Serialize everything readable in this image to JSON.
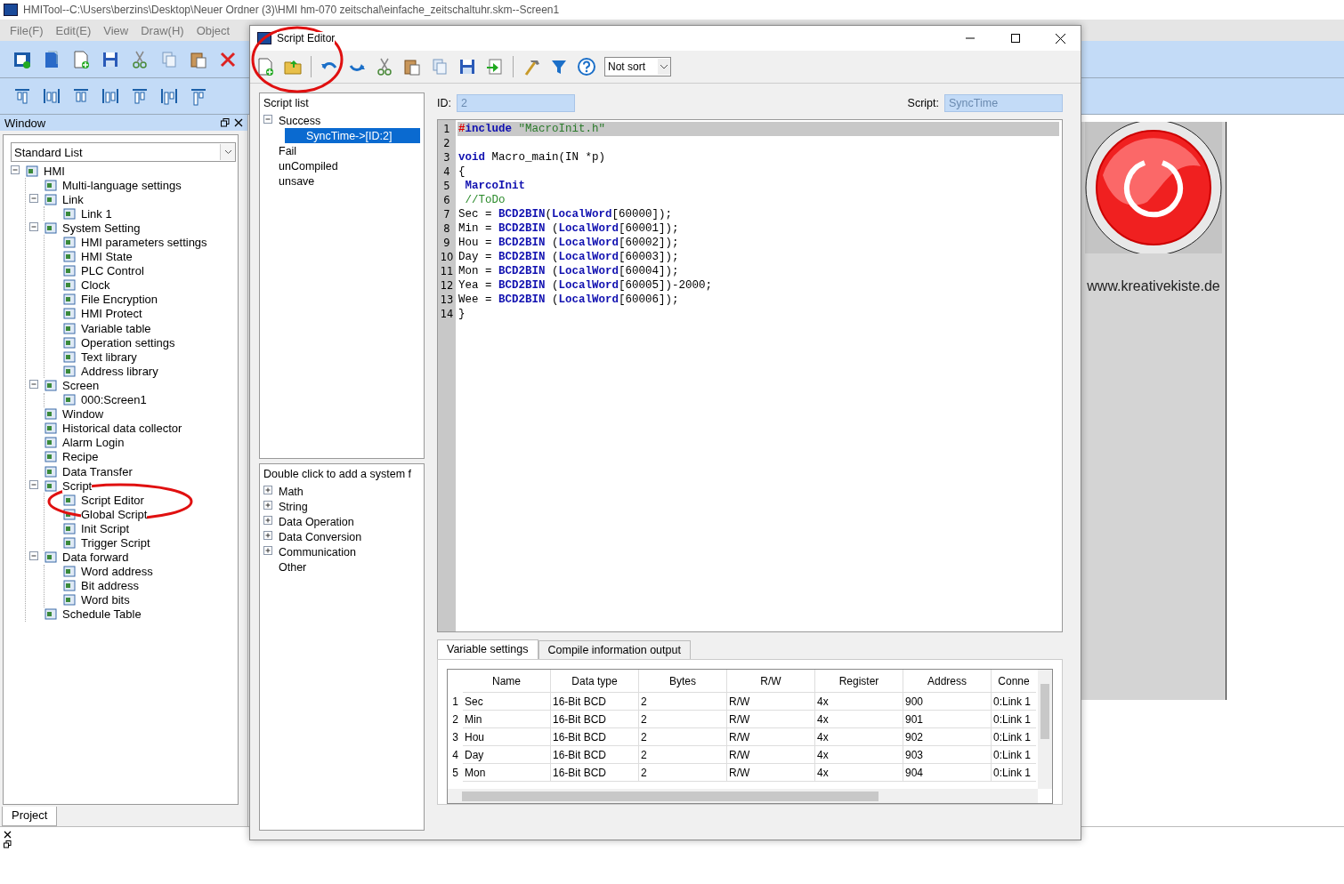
{
  "window": {
    "title": "HMITool--C:\\Users\\berzins\\Desktop\\Neuer Ordner (3)\\HMI hm-070 zeitschal\\einfache_zeitschaltuhr.skm--Screen1"
  },
  "menu": [
    "File(F)",
    "Edit(E)",
    "View",
    "Draw(H)",
    "Object"
  ],
  "left_panel": {
    "title": "Window",
    "dropdown": "Standard List",
    "tab": "Project",
    "tree": [
      {
        "label": "HMI",
        "expanded": true,
        "children": [
          {
            "label": "Multi-language settings"
          },
          {
            "label": "Link",
            "expanded": true,
            "children": [
              {
                "label": "Link 1"
              }
            ]
          },
          {
            "label": "System Setting",
            "expanded": true,
            "children": [
              {
                "label": "HMI parameters settings"
              },
              {
                "label": "HMI State"
              },
              {
                "label": "PLC Control"
              },
              {
                "label": "Clock"
              },
              {
                "label": "File Encryption"
              },
              {
                "label": "HMI Protect"
              },
              {
                "label": "Variable table"
              },
              {
                "label": "Operation settings"
              },
              {
                "label": "Text library"
              },
              {
                "label": "Address library"
              }
            ]
          },
          {
            "label": "Screen",
            "expanded": true,
            "children": [
              {
                "label": "000:Screen1"
              }
            ]
          },
          {
            "label": "Window"
          },
          {
            "label": "Historical data collector"
          },
          {
            "label": "Alarm Login"
          },
          {
            "label": "Recipe"
          },
          {
            "label": "Data Transfer"
          },
          {
            "label": "Script",
            "expanded": true,
            "children": [
              {
                "label": "Script Editor"
              },
              {
                "label": "Global Script"
              },
              {
                "label": "Init Script"
              },
              {
                "label": "Trigger Script"
              }
            ]
          },
          {
            "label": "Data forward",
            "expanded": true,
            "children": [
              {
                "label": "Word address"
              },
              {
                "label": "Bit address"
              },
              {
                "label": "Word bits"
              }
            ]
          },
          {
            "label": "Schedule Table"
          }
        ]
      }
    ]
  },
  "canvas": {
    "caption": "www.kreativekiste.de"
  },
  "dialog": {
    "title": "Script Editor",
    "sort": "Not sort",
    "script_list": {
      "title": "Script list",
      "items": [
        {
          "label": "Success",
          "selected": false,
          "expanded": true,
          "children": [
            {
              "label": "SyncTime->[ID:2]",
              "selected": true
            }
          ]
        },
        {
          "label": "Fail",
          "selected": false
        },
        {
          "label": "unCompiled",
          "selected": false
        },
        {
          "label": "unsave",
          "selected": false
        }
      ]
    },
    "functions": {
      "title": "Double click to add a system f",
      "items": [
        {
          "label": "Math",
          "kind": "folder",
          "expanded": false
        },
        {
          "label": "String",
          "kind": "folder",
          "expanded": false
        },
        {
          "label": "Data Operation",
          "kind": "folder",
          "expanded": false
        },
        {
          "label": "Data Conversion",
          "kind": "folder",
          "expanded": false
        },
        {
          "label": "Communication",
          "kind": "folder",
          "expanded": false
        },
        {
          "label": "Other",
          "kind": "leaf"
        }
      ]
    },
    "id": {
      "label": "ID:",
      "value": "2"
    },
    "script": {
      "label": "Script:",
      "value": "SyncTime"
    },
    "code": [
      {
        "number": "1",
        "current": true,
        "tokens": [
          {
            "kind": "pre",
            "text": "#"
          },
          {
            "kind": "keyword",
            "text": "include"
          },
          {
            "kind": "string",
            "text": " \"MacroInit.h\""
          }
        ]
      },
      {
        "number": "2",
        "current": false
      },
      {
        "number": "3",
        "current": false,
        "tokens": [
          {
            "kind": "keyword",
            "text": "void"
          },
          {
            "kind": "plain",
            "text": " Macro_main(IN *p)"
          }
        ]
      },
      {
        "number": "4",
        "current": false,
        "tokens": [
          {
            "kind": "plain",
            "text": "{"
          }
        ]
      },
      {
        "number": "5",
        "current": false,
        "tokens": [
          {
            "kind": "keyword",
            "text": " MarcoInit"
          }
        ]
      },
      {
        "number": "6",
        "current": false,
        "tokens": [
          {
            "kind": "comment",
            "text": " //ToDo"
          }
        ]
      },
      {
        "number": "7",
        "current": false,
        "tokens": [
          {
            "kind": "plain",
            "text": "Sec = "
          },
          {
            "kind": "keyword",
            "text": "BCD2BIN"
          },
          {
            "kind": "plain",
            "text": "("
          },
          {
            "kind": "keyword",
            "text": "LocalWord"
          },
          {
            "kind": "plain",
            "text": "[60000]);"
          }
        ]
      },
      {
        "number": "8",
        "current": false,
        "tokens": [
          {
            "kind": "plain",
            "text": "Min = "
          },
          {
            "kind": "keyword",
            "text": "BCD2BIN"
          },
          {
            "kind": "plain",
            "text": " ("
          },
          {
            "kind": "keyword",
            "text": "LocalWord"
          },
          {
            "kind": "plain",
            "text": "[60001]);"
          }
        ]
      },
      {
        "number": "9",
        "current": false,
        "tokens": [
          {
            "kind": "plain",
            "text": "Hou = "
          },
          {
            "kind": "keyword",
            "text": "BCD2BIN"
          },
          {
            "kind": "plain",
            "text": " ("
          },
          {
            "kind": "keyword",
            "text": "LocalWord"
          },
          {
            "kind": "plain",
            "text": "[60002]);"
          }
        ]
      },
      {
        "number": "10",
        "current": false,
        "tokens": [
          {
            "kind": "plain",
            "text": "Day = "
          },
          {
            "kind": "keyword",
            "text": "BCD2BIN"
          },
          {
            "kind": "plain",
            "text": " ("
          },
          {
            "kind": "keyword",
            "text": "LocalWord"
          },
          {
            "kind": "plain",
            "text": "[60003]);"
          }
        ]
      },
      {
        "number": "11",
        "current": false,
        "tokens": [
          {
            "kind": "plain",
            "text": "Mon = "
          },
          {
            "kind": "keyword",
            "text": "BCD2BIN"
          },
          {
            "kind": "plain",
            "text": " ("
          },
          {
            "kind": "keyword",
            "text": "LocalWord"
          },
          {
            "kind": "plain",
            "text": "[60004]);"
          }
        ]
      },
      {
        "number": "12",
        "current": false,
        "tokens": [
          {
            "kind": "plain",
            "text": "Yea = "
          },
          {
            "kind": "keyword",
            "text": "BCD2BIN"
          },
          {
            "kind": "plain",
            "text": " ("
          },
          {
            "kind": "keyword",
            "text": "LocalWord"
          },
          {
            "kind": "plain",
            "text": "[60005])-2000;"
          }
        ]
      },
      {
        "number": "13",
        "current": false,
        "tokens": [
          {
            "kind": "plain",
            "text": "Wee = "
          },
          {
            "kind": "keyword",
            "text": "BCD2BIN"
          },
          {
            "kind": "plain",
            "text": " ("
          },
          {
            "kind": "keyword",
            "text": "LocalWord"
          },
          {
            "kind": "plain",
            "text": "[60006]);"
          }
        ]
      },
      {
        "number": "14",
        "current": false,
        "tokens": [
          {
            "kind": "plain",
            "text": "}"
          }
        ]
      }
    ],
    "tabs": [
      {
        "label": "Variable settings",
        "selected": true
      },
      {
        "label": "Compile information output",
        "selected": false
      }
    ],
    "table": {
      "columns": [
        "Name",
        "Data type",
        "Bytes",
        "R/W",
        "Register",
        "Address",
        "Conne"
      ],
      "rows": [
        {
          "number": "1",
          "cells": [
            "Sec",
            "16-Bit BCD",
            "2",
            "R/W",
            "4x",
            "900",
            "0:Link 1"
          ]
        },
        {
          "number": "2",
          "cells": [
            "Min",
            "16-Bit BCD",
            "2",
            "R/W",
            "4x",
            "901",
            "0:Link 1"
          ]
        },
        {
          "number": "3",
          "cells": [
            "Hou",
            "16-Bit BCD",
            "2",
            "R/W",
            "4x",
            "902",
            "0:Link 1"
          ]
        },
        {
          "number": "4",
          "cells": [
            "Day",
            "16-Bit BCD",
            "2",
            "R/W",
            "4x",
            "903",
            "0:Link 1"
          ]
        },
        {
          "number": "5",
          "cells": [
            "Mon",
            "16-Bit BCD",
            "2",
            "R/W",
            "4x",
            "904",
            "0:Link 1"
          ]
        }
      ]
    }
  }
}
